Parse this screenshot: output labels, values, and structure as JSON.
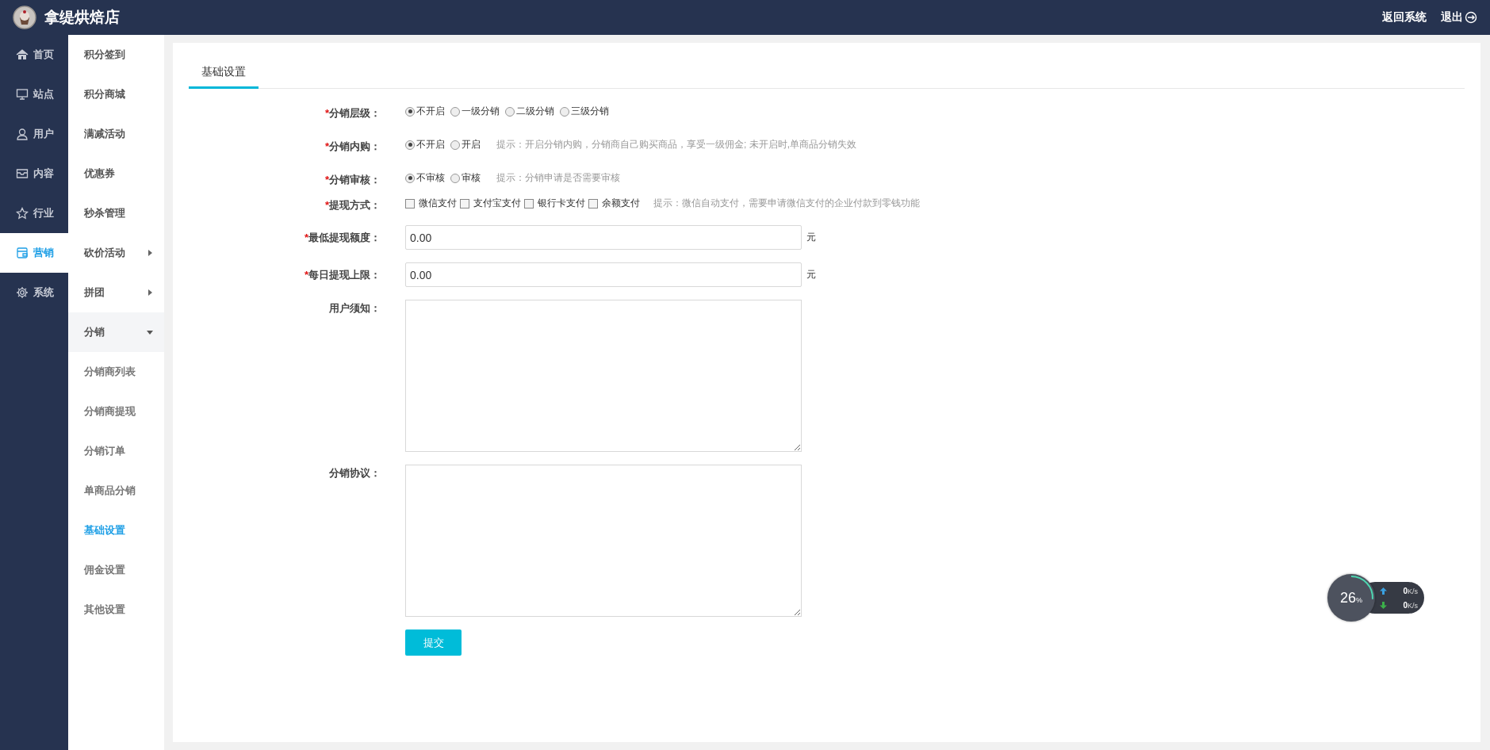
{
  "header": {
    "store_name": "拿缇烘焙店",
    "links": [
      {
        "label": "返回系统"
      },
      {
        "label": "退出"
      }
    ]
  },
  "main_nav": [
    {
      "label": "首页",
      "selected": false
    },
    {
      "label": "站点",
      "selected": false
    },
    {
      "label": "用户",
      "selected": false
    },
    {
      "label": "内容",
      "selected": false
    },
    {
      "label": "行业",
      "selected": false
    },
    {
      "label": "营销",
      "selected": true
    },
    {
      "label": "系统",
      "selected": false
    }
  ],
  "sub_nav": [
    {
      "label": "积分签到",
      "selected": false
    },
    {
      "label": "积分商城",
      "selected": false
    },
    {
      "label": "满减活动",
      "selected": false
    },
    {
      "label": "优惠券",
      "selected": false
    },
    {
      "label": "秒杀管理",
      "selected": false
    },
    {
      "label": "砍价活动",
      "expanded": false,
      "selected": false
    },
    {
      "label": "拼团",
      "expanded": false,
      "selected": false
    },
    {
      "label": "分销",
      "expanded": true,
      "selected": false,
      "children": [
        {
          "label": "分销商列表",
          "selected": false
        },
        {
          "label": "分销商提现",
          "selected": false
        },
        {
          "label": "分销订单",
          "selected": false
        },
        {
          "label": "单商品分销",
          "selected": false
        },
        {
          "label": "基础设置",
          "selected": true
        },
        {
          "label": "佣金设置",
          "selected": false
        },
        {
          "label": "其他设置",
          "selected": false
        }
      ]
    }
  ],
  "tabs": [
    {
      "label": "基础设置",
      "selected": true
    }
  ],
  "form": [
    {
      "kind": "radio",
      "required_mark": "*",
      "label": "分销层级：",
      "options": [
        {
          "label": "不开启",
          "selected": true
        },
        {
          "label": "一级分销",
          "selected": false
        },
        {
          "label": "二级分销",
          "selected": false
        },
        {
          "label": "三级分销",
          "selected": false
        }
      ]
    },
    {
      "kind": "radio",
      "required_mark": "*",
      "label": "分销内购：",
      "options": [
        {
          "label": "不开启",
          "selected": true
        },
        {
          "label": "开启",
          "selected": false
        }
      ],
      "hint": "提示：开启分销内购，分销商自己购买商品，享受一级佣金; 未开启时,单商品分销失效"
    },
    {
      "kind": "radio",
      "required_mark": "*",
      "label": "分销审核：",
      "options": [
        {
          "label": "不审核",
          "selected": true
        },
        {
          "label": "审核",
          "selected": false
        }
      ],
      "hint": "提示：分销申请是否需要审核"
    },
    {
      "kind": "checkbox",
      "required_mark": "*",
      "label": "提现方式：",
      "options": [
        {
          "label": "微信支付",
          "checked": false
        },
        {
          "label": "支付宝支付",
          "checked": false
        },
        {
          "label": "银行卡支付",
          "checked": false
        },
        {
          "label": "余额支付",
          "checked": false
        }
      ],
      "hint": "提示：微信自动支付，需要申请微信支付的企业付款到零钱功能"
    },
    {
      "kind": "text",
      "required_mark": "*",
      "label": "最低提现额度：",
      "value": "0.00",
      "unit": "元"
    },
    {
      "kind": "text",
      "required_mark": "*",
      "label": "每日提现上限：",
      "value": "0.00",
      "unit": "元"
    },
    {
      "kind": "textarea",
      "label": "用户须知："
    },
    {
      "kind": "textarea",
      "label": "分销协议："
    }
  ],
  "submit": "提交",
  "speed_widget": {
    "percent": "26",
    "percent_sign": "%",
    "upload": "0",
    "upload_unit": "K/s",
    "download": "0",
    "download_unit": "K/s"
  }
}
